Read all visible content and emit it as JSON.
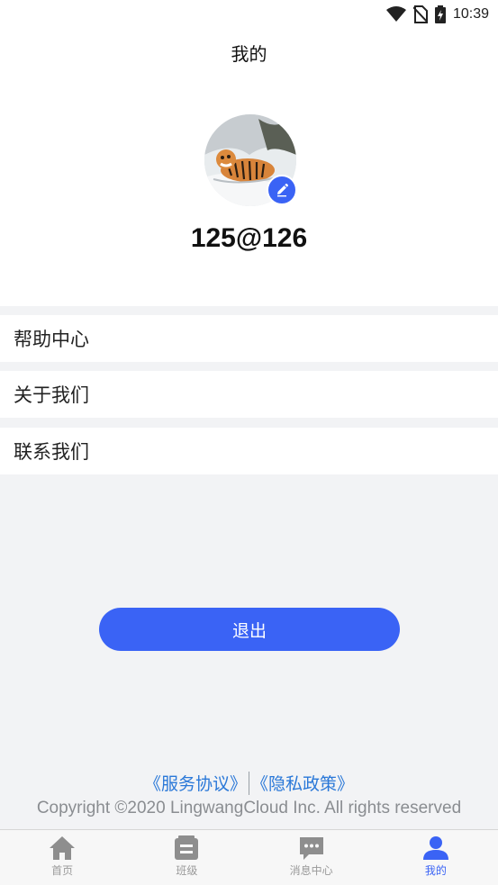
{
  "status_bar": {
    "time": "10:39"
  },
  "header": {
    "title": "我的"
  },
  "profile": {
    "username": "125@126"
  },
  "menu": {
    "help": "帮助中心",
    "about": "关于我们",
    "contact": "联系我们"
  },
  "logout_label": "退出",
  "footer": {
    "service_agreement": "《服务协议》",
    "privacy_policy": "《隐私政策》",
    "copyright": "Copyright ©2020 LingwangCloud Inc. All rights reserved"
  },
  "tabs": [
    {
      "label": "首页",
      "icon": "home-icon",
      "active": false
    },
    {
      "label": "班级",
      "icon": "class-icon",
      "active": false
    },
    {
      "label": "消息中心",
      "icon": "message-icon",
      "active": false
    },
    {
      "label": "我的",
      "icon": "user-icon",
      "active": true
    }
  ],
  "colors": {
    "accent": "#3a63f5",
    "link": "#2a78d8",
    "background": "#f2f3f5"
  }
}
